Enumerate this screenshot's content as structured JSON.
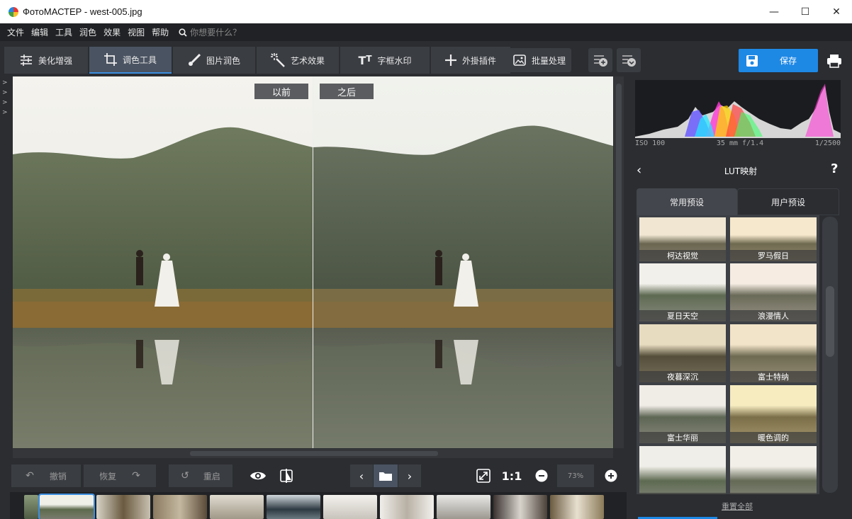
{
  "window": {
    "title": "ФотоМАСТЕР - west-005.jpg",
    "minimize": "—",
    "maximize": "☐",
    "close": "✕"
  },
  "menu": {
    "items": [
      "文件",
      "编辑",
      "工具",
      "润色",
      "效果",
      "视图",
      "帮助"
    ],
    "search_placeholder": "你想要什么？"
  },
  "toolbar": {
    "tabs": [
      {
        "label": "美化增强",
        "icon": "sliders-icon"
      },
      {
        "label": "调色工具",
        "icon": "crop-icon",
        "active": true
      },
      {
        "label": "图片润色",
        "icon": "brush-icon"
      },
      {
        "label": "艺术效果",
        "icon": "magic-wand-icon"
      },
      {
        "label": "字框水印",
        "icon": "text-icon"
      },
      {
        "label": "外掛插件",
        "icon": "plus-icon"
      }
    ],
    "batch_label": "批量处理",
    "save_label": "保存"
  },
  "canvas": {
    "before_label": "以前",
    "after_label": "之后"
  },
  "bottom": {
    "undo_label": "撤销",
    "redo_label": "恢复",
    "reset_label": "重启",
    "actual_size": "1:1",
    "zoom_value": "73%"
  },
  "panel": {
    "exif": {
      "iso": "ISO 100",
      "lens": "35 mm f/1.4",
      "shutter": "1/2500"
    },
    "title": "LUT映射",
    "help": "?",
    "tabs": [
      "常用预设",
      "用户预设"
    ],
    "presets": [
      "柯达视觉",
      "罗马假日",
      "夏日天空",
      "浪漫情人",
      "夜暮深沉",
      "富士特纳",
      "富士华丽",
      "暖色调的",
      "",
      ""
    ],
    "reset_all": "重置全部"
  },
  "colors": {
    "accent": "#1e88e5",
    "panel_bg": "#2b2d31",
    "button_bg": "#3a3d42"
  }
}
